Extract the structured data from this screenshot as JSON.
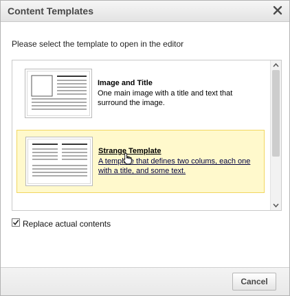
{
  "dialog": {
    "title": "Content Templates",
    "prompt": "Please select the template to open in the editor",
    "templates": [
      {
        "title": "Image and Title",
        "description": "One main image with a title and text that surround the image.",
        "selected": false
      },
      {
        "title": "Strange Template",
        "description": "A template that defines two colums, each one with a title, and some text.",
        "selected": true
      }
    ],
    "replace_checkbox": {
      "label": "Replace actual contents",
      "checked": true
    },
    "cancel_label": "Cancel"
  },
  "colors": {
    "selected_bg": "#fff9cc",
    "selected_border": "#f1d65e"
  },
  "icons": [
    "close-icon",
    "checkbox-check-icon",
    "scroll-up-icon",
    "scroll-down-icon",
    "hand-cursor-icon"
  ]
}
